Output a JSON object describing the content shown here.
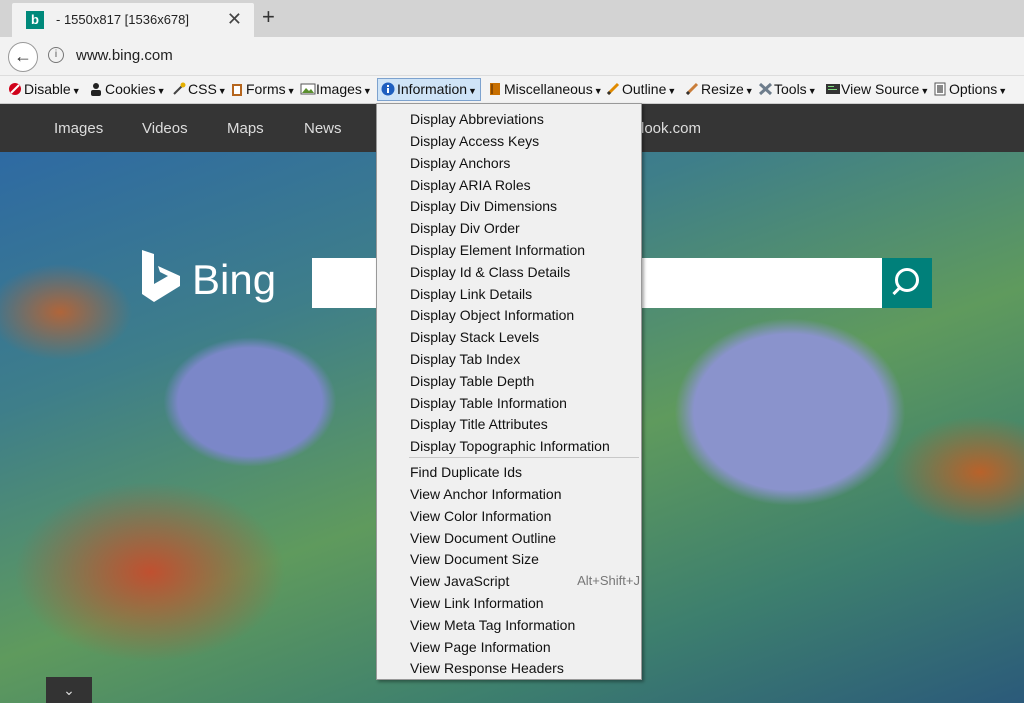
{
  "tab": {
    "title": "- 1550x817 [1536x678]",
    "favicon": "b"
  },
  "address": {
    "url": "www.bing.com"
  },
  "devtoolbar": {
    "items": [
      {
        "label": "Disable",
        "icon": "disable-icon",
        "color": "#d0021b"
      },
      {
        "label": "Cookies",
        "icon": "cookie-person-icon",
        "color": "#222222"
      },
      {
        "label": "CSS",
        "icon": "css-wand-icon",
        "color": "#e5b000"
      },
      {
        "label": "Forms",
        "icon": "forms-clipboard-icon",
        "color": "#b5651d"
      },
      {
        "label": "Images",
        "icon": "images-picture-icon",
        "color": "#5a8f2e"
      },
      {
        "label": "Information",
        "icon": "information-icon",
        "color": "#1f5fbf"
      },
      {
        "label": "Miscellaneous",
        "icon": "miscellaneous-book-icon",
        "color": "#c86f00"
      },
      {
        "label": "Outline",
        "icon": "outline-pencil-icon",
        "color": "#e08a00"
      },
      {
        "label": "Resize",
        "icon": "resize-pencil-icon",
        "color": "#c97d3a"
      },
      {
        "label": "Tools",
        "icon": "tools-icon",
        "color": "#6e7d8c"
      },
      {
        "label": "View Source",
        "icon": "view-source-icon",
        "color": "#333333"
      },
      {
        "label": "Options",
        "icon": "options-icon",
        "color": "#555555"
      }
    ]
  },
  "bing": {
    "nav": [
      "Images",
      "Videos",
      "Maps",
      "News"
    ],
    "nav_right": "look.com",
    "logo": "Bing",
    "scroll_glyph": "⌄"
  },
  "menu": {
    "items": [
      "Display Abbreviations",
      "Display Access Keys",
      "Display Anchors",
      "Display ARIA Roles",
      "Display Div Dimensions",
      "Display Div Order",
      "Display Element Information",
      "Display Id & Class Details",
      "Display Link Details",
      "Display Object Information",
      "Display Stack Levels",
      "Display Tab Index",
      "Display Table Depth",
      "Display Table Information",
      "Display Title Attributes",
      "Display Topographic Information",
      "Find Duplicate Ids",
      "View Anchor Information",
      "View Color Information",
      "View Document Outline",
      "View Document Size",
      "View JavaScript",
      "View Link Information",
      "View Meta Tag Information",
      "View Page Information",
      "View Response Headers"
    ],
    "javascript_shortcut": "Alt+Shift+J"
  }
}
